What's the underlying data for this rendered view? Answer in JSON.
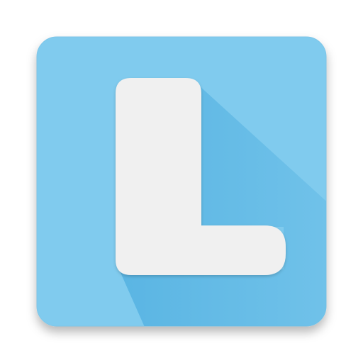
{
  "icon": {
    "name": "letter-l-app-icon",
    "letter": "L",
    "colors": {
      "tile": "#80cbee",
      "tile_border": "#7ec6e8",
      "long_shadow": "#5ab5e3",
      "glyph": "#f0f0f0",
      "drop_shadow": "#000000"
    }
  }
}
